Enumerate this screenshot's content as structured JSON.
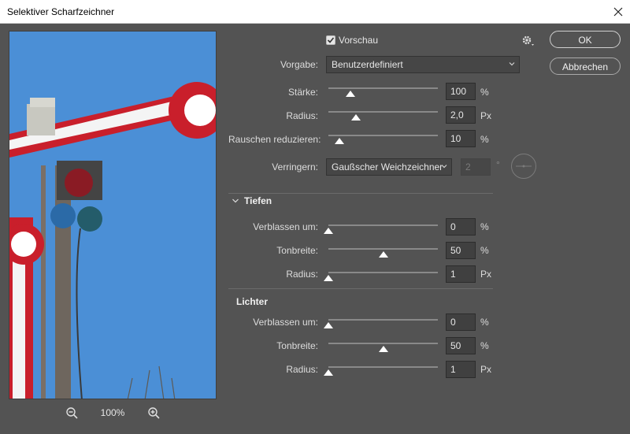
{
  "window": {
    "title": "Selektiver Scharfzeichner"
  },
  "preview_toggle": {
    "label": "Vorschau",
    "checked": true
  },
  "buttons": {
    "ok": "OK",
    "cancel": "Abbrechen"
  },
  "preset": {
    "label": "Vorgabe:",
    "value": "Benutzerdefiniert"
  },
  "main": {
    "amount": {
      "label": "Stärke:",
      "value": "100",
      "unit": "%",
      "level": 0.2
    },
    "radius": {
      "label": "Radius:",
      "value": "2,0",
      "unit": "Px",
      "level": 0.25
    },
    "noise": {
      "label": "Rauschen reduzieren:",
      "value": "10",
      "unit": "%",
      "level": 0.1
    }
  },
  "remove": {
    "label": "Verringern:",
    "value": "Gaußscher Weichzeichner",
    "angle": "2",
    "angle_unit": "°"
  },
  "shadows": {
    "title": "Tiefen",
    "fade": {
      "label": "Verblassen um:",
      "value": "0",
      "unit": "%",
      "level": 0.0
    },
    "tonal": {
      "label": "Tonbreite:",
      "value": "50",
      "unit": "%",
      "level": 0.5
    },
    "radius": {
      "label": "Radius:",
      "value": "1",
      "unit": "Px",
      "level": 0.0
    }
  },
  "highlights": {
    "title": "Lichter",
    "fade": {
      "label": "Verblassen um:",
      "value": "0",
      "unit": "%",
      "level": 0.0
    },
    "tonal": {
      "label": "Tonbreite:",
      "value": "50",
      "unit": "%",
      "level": 0.5
    },
    "radius": {
      "label": "Radius:",
      "value": "1",
      "unit": "Px",
      "level": 0.0
    }
  },
  "zoom": {
    "level": "100%"
  },
  "icons": {
    "close": "close-icon",
    "settings": "gear-icon",
    "zoom_out": "zoom-out-icon",
    "zoom_in": "zoom-in-icon",
    "angle": "angle-dial-icon",
    "collapse": "chevron-down-icon"
  },
  "colors": {
    "background": "#535353",
    "field": "#404040",
    "sky": "#4d90d5",
    "signal_red": "#d0202c"
  }
}
